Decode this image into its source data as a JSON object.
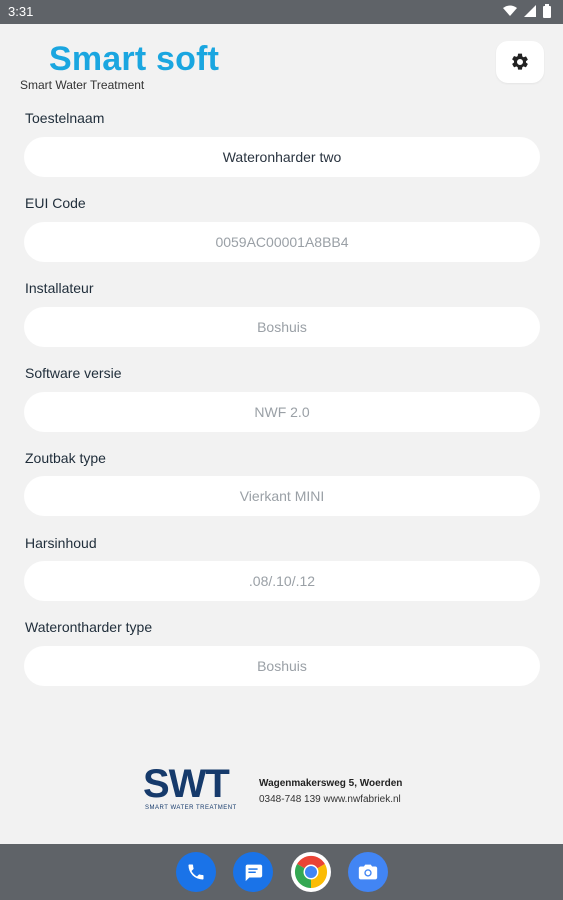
{
  "status_bar": {
    "time": "3:31"
  },
  "header": {
    "title": "Smart soft",
    "subtitle": "Smart Water Treatment"
  },
  "fields": [
    {
      "label": "Toestelnaam",
      "value": "Wateronharder two",
      "state": "active"
    },
    {
      "label": "EUI Code",
      "value": "0059AC00001A8BB4",
      "state": "dim"
    },
    {
      "label": "Installateur",
      "value": "Boshuis",
      "state": "dim"
    },
    {
      "label": "Software versie",
      "value": "NWF 2.0",
      "state": "dim"
    },
    {
      "label": "Zoutbak type",
      "value": "Vierkant MINI",
      "state": "dim"
    },
    {
      "label": "Harsinhoud",
      "value": ".08/.10/.12",
      "state": "dim"
    },
    {
      "label": "Waterontharder type",
      "value": "Boshuis",
      "state": "dim"
    }
  ],
  "footer": {
    "logo_text": "SWT",
    "logo_tagline": "SMART WATER TREATMENT",
    "address": "Wagenmakersweg 5, Woerden",
    "contact": "0348-748 139 www.nwfabriek.nl"
  },
  "dock": [
    {
      "name": "phone-icon",
      "color": "#1a73e8"
    },
    {
      "name": "messages-icon",
      "color": "#1a73e8"
    },
    {
      "name": "chrome-icon",
      "color": "#ffffff"
    },
    {
      "name": "camera-icon",
      "color": "#4285f4"
    }
  ],
  "colors": {
    "brand": "#1aa6e0",
    "logo": "#163a6b",
    "bar": "#5f6368"
  }
}
